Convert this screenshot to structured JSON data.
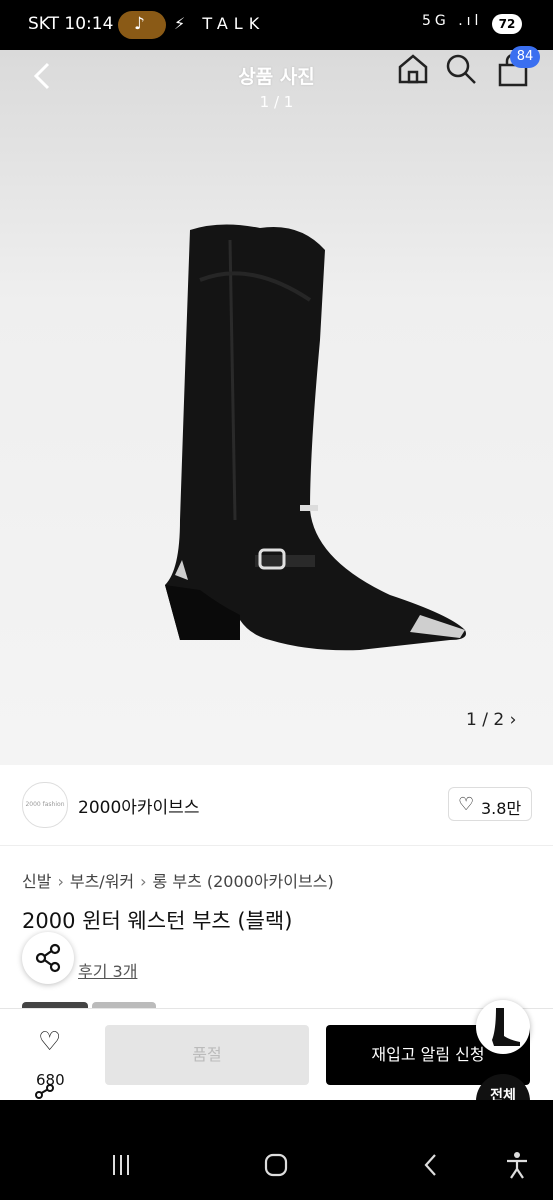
{
  "status_bar": {
    "time": "SKT 10:14",
    "pill_icon": "♪",
    "left_icons": "⚡ TALK",
    "right_icons": "5G .ıl",
    "battery": "72"
  },
  "header": {
    "title": "상품 사진",
    "subtitle": "1 / 1",
    "cart_count": "84"
  },
  "gallery": {
    "counter": "1 / 2 ›"
  },
  "seller": {
    "logo_text": "2000 fashion",
    "name": "2000아카이브스",
    "likes": "3.8만"
  },
  "breadcrumb": {
    "items": [
      "신발",
      "부츠/워커",
      "롱 부츠 (2000아카이브스)"
    ]
  },
  "product": {
    "title": "2000 윈터 웨스턴 부츠 (블랙)",
    "reviews": "후기 3개"
  },
  "bottom_bar": {
    "wish_count": "680",
    "soldout_label": "품절",
    "restock_label": "재입고 알림 신청",
    "all_label": "전체"
  },
  "colors": {
    "accent_badge": "#3a6ff0",
    "primary_button": "#000000",
    "disabled_button": "#e5e5e5"
  }
}
